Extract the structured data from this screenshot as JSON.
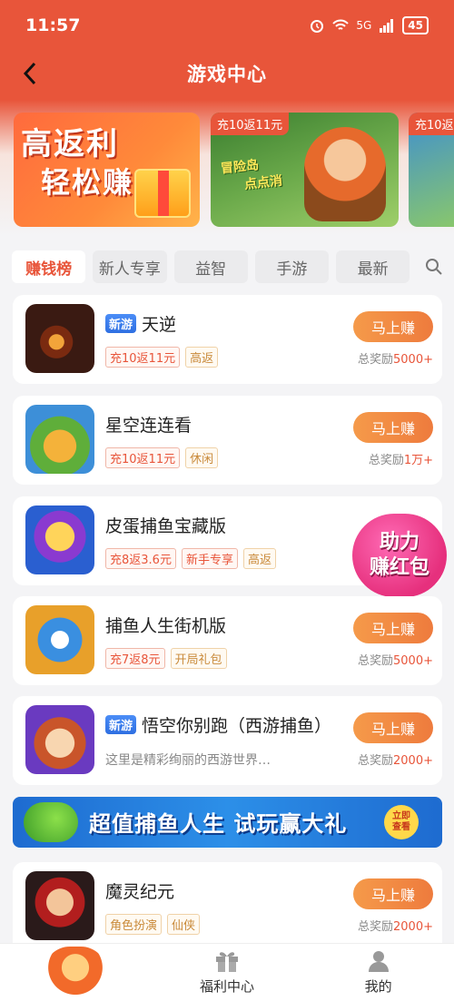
{
  "status_bar": {
    "time": "11:57",
    "network": "5G",
    "battery": "45"
  },
  "nav": {
    "title": "游戏中心"
  },
  "banners": [
    {
      "line1": "高返利",
      "line2": "轻松赚"
    },
    {
      "tag": "充10返11元",
      "logo_line1": "冒险岛",
      "logo_line2": "点点消"
    },
    {
      "tag": "充10返"
    }
  ],
  "tabs": [
    "赚钱榜",
    "新人专享",
    "益智",
    "手游",
    "最新"
  ],
  "games": [
    {
      "badge": "新游",
      "title": "天逆",
      "tags": [
        "充10返11元",
        "高返"
      ],
      "button": "马上赚",
      "reward_prefix": "总奖励",
      "reward_value": "5000+"
    },
    {
      "title": "星空连连看",
      "tags": [
        "充10返11元",
        "休闲"
      ],
      "button": "马上赚",
      "reward_prefix": "总奖励",
      "reward_value": "1万+"
    },
    {
      "title": "皮蛋捕鱼宝藏版",
      "tags": [
        "充8返3.6元",
        "新手专享",
        "高返"
      ]
    },
    {
      "title": "捕鱼人生街机版",
      "tags": [
        "充7返8元",
        "开局礼包"
      ],
      "button": "马上赚",
      "reward_prefix": "总奖励",
      "reward_value": "5000+"
    },
    {
      "badge": "新游",
      "title": "悟空你别跑（西游捕鱼）",
      "desc": "这里是精彩绚丽的西游世界…",
      "button": "马上赚",
      "reward_prefix": "总奖励",
      "reward_value": "2000+"
    },
    {
      "title": "魔灵纪元",
      "tags": [
        "角色扮演",
        "仙侠"
      ],
      "button": "马上赚",
      "reward_prefix": "总奖励",
      "reward_value": "2000+"
    }
  ],
  "help_badge": {
    "line1": "助力",
    "line2": "赚红包"
  },
  "promo": {
    "text": "超值捕鱼人生 试玩赢大礼",
    "btn_line1": "立即",
    "btn_line2": "查看"
  },
  "bottom_nav": [
    {
      "label": ""
    },
    {
      "label": "福利中心"
    },
    {
      "label": "我的"
    }
  ]
}
